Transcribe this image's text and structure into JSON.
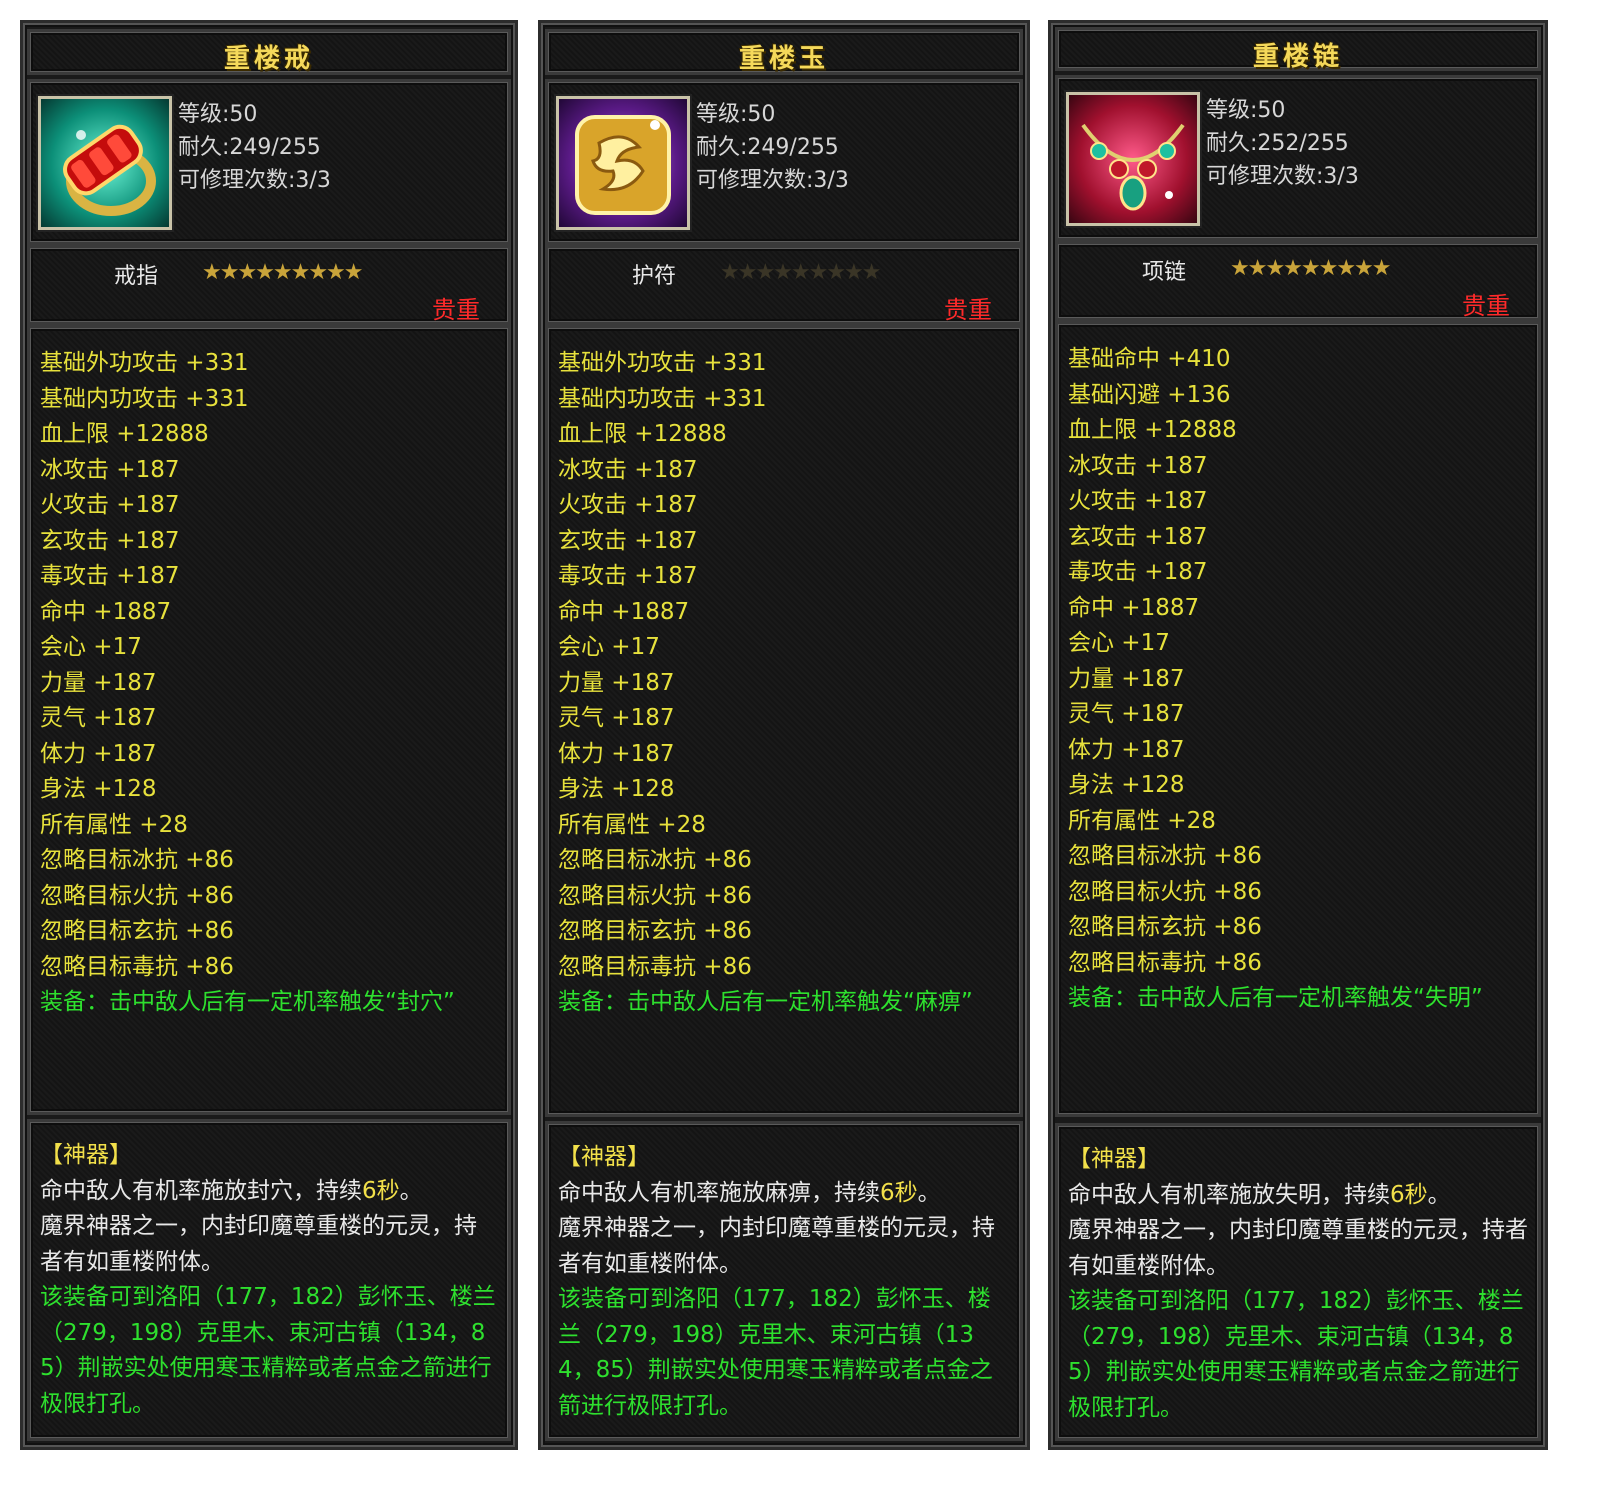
{
  "cards": [
    {
      "title": "重楼戒",
      "icon": "ring-icon",
      "level": "等级:50",
      "durability": "耐久:249/255",
      "repair": "可修理次数:3/3",
      "type": "戒指",
      "stars": "★★★★★★★★★",
      "precious": "贵重",
      "attributes": [
        "基础外功攻击 +331",
        "基础内功攻击 +331",
        "血上限 +12888",
        "冰攻击 +187",
        "火攻击 +187",
        "玄攻击 +187",
        "毒攻击 +187",
        "命中 +1887",
        "会心 +17",
        "力量 +187",
        "灵气 +187",
        "体力 +187",
        "身法 +128",
        "所有属性 +28",
        "忽略目标冰抗 +86",
        "忽略目标火抗 +86",
        "忽略目标玄抗 +86",
        "忽略目标毒抗 +86"
      ],
      "equip": "装备：击中敌人后有一定机率触发“封穴”",
      "shenqi": "【神器】",
      "desc1": "命中敌人有机率施放封穴，持续",
      "desc1_time": "6秒",
      "desc1_end": "。",
      "desc2": "魔界神器之一，内封印魔尊重楼的元灵，持者有如重楼附体。",
      "desc3": "该装备可到洛阳（177，182）彭怀玉、楼兰（279，198）克里木、束河古镇（134，85）荆嵌实处使用寒玉精粹或者点金之箭进行极限打孔。"
    },
    {
      "title": "重楼玉",
      "icon": "jade-pendant-icon",
      "level": "等级:50",
      "durability": "耐久:249/255",
      "repair": "可修理次数:3/3",
      "type": "护符",
      "stars": "★★★★★★★★★",
      "precious": "贵重",
      "attributes": [
        "基础外功攻击 +331",
        "基础内功攻击 +331",
        "血上限 +12888",
        "冰攻击 +187",
        "火攻击 +187",
        "玄攻击 +187",
        "毒攻击 +187",
        "命中 +1887",
        "会心 +17",
        "力量 +187",
        "灵气 +187",
        "体力 +187",
        "身法 +128",
        "所有属性 +28",
        "忽略目标冰抗 +86",
        "忽略目标火抗 +86",
        "忽略目标玄抗 +86",
        "忽略目标毒抗 +86"
      ],
      "equip": "装备：击中敌人后有一定机率触发“麻痹”",
      "shenqi": "【神器】",
      "desc1": "命中敌人有机率施放麻痹，持续",
      "desc1_time": "6秒",
      "desc1_end": "。",
      "desc2": "魔界神器之一，内封印魔尊重楼的元灵，持者有如重楼附体。",
      "desc3": "该装备可到洛阳（177，182）彭怀玉、楼兰（279，198）克里木、束河古镇（134，85）荆嵌实处使用寒玉精粹或者点金之箭进行极限打孔。"
    },
    {
      "title": "重楼链",
      "icon": "necklace-icon",
      "level": "等级:50",
      "durability": "耐久:252/255",
      "repair": "可修理次数:3/3",
      "type": "项链",
      "stars": "★★★★★★★★★",
      "precious": "贵重",
      "attributes": [
        "基础命中 +410",
        "基础闪避 +136",
        "血上限 +12888",
        "冰攻击 +187",
        "火攻击 +187",
        "玄攻击 +187",
        "毒攻击 +187",
        "命中 +1887",
        "会心 +17",
        "力量 +187",
        "灵气 +187",
        "体力 +187",
        "身法 +128",
        "所有属性 +28",
        "忽略目标冰抗 +86",
        "忽略目标火抗 +86",
        "忽略目标玄抗 +86",
        "忽略目标毒抗 +86"
      ],
      "equip": "装备：击中敌人后有一定机率触发“失明”",
      "shenqi": "【神器】",
      "desc1": "命中敌人有机率施放失明，持续",
      "desc1_time": "6秒",
      "desc1_end": "。",
      "desc2": "魔界神器之一，内封印魔尊重楼的元灵，持者有如重楼附体。",
      "desc3": "该装备可到洛阳（177，182）彭怀玉、楼兰（279，198）克里木、束河古镇（134，85）荆嵌实处使用寒玉精粹或者点金之箭进行极限打孔。"
    }
  ],
  "colors": {
    "attribute": "#e7e13c",
    "equip": "#2ee02e",
    "precious": "#ff2a2a",
    "title": "#f5d95a",
    "star_gold": "#c9a43a",
    "star_dim": "#3a3526"
  }
}
